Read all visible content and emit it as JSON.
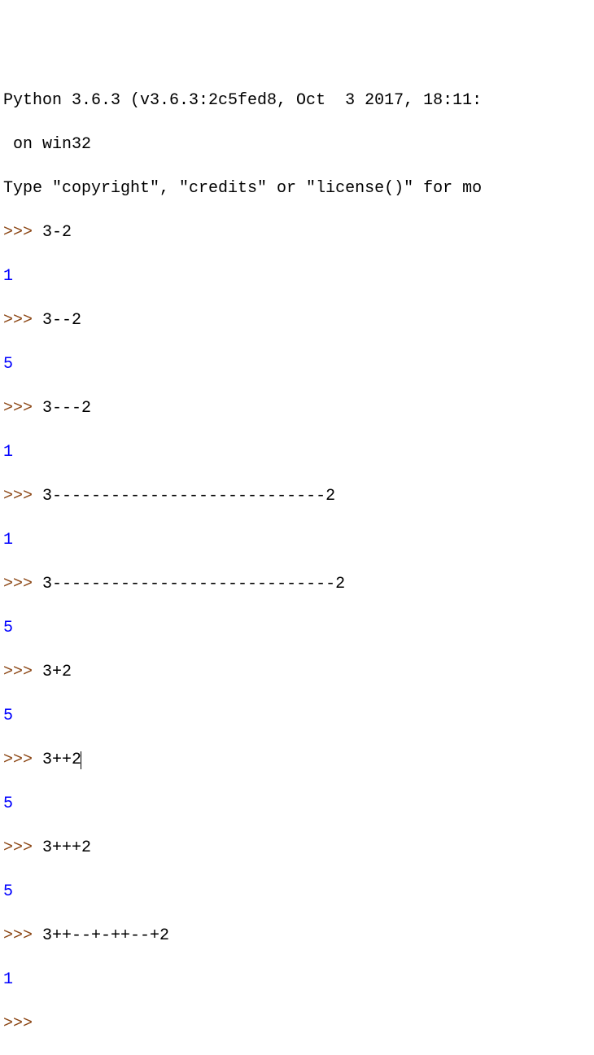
{
  "header": {
    "line1": "Python 3.6.3 (v3.6.3:2c5fed8, Oct  3 2017, 18:11:",
    "line2": " on win32",
    "line3": "Type \"copyright\", \"credits\" or \"license()\" for mo"
  },
  "prompt": ">>> ",
  "session": [
    {
      "input": "3-2",
      "output": "1"
    },
    {
      "input": "3--2",
      "output": "5"
    },
    {
      "input": "3---2",
      "output": "1"
    },
    {
      "input": "3----------------------------2",
      "output": "1"
    },
    {
      "input": "3-----------------------------2",
      "output": "5"
    },
    {
      "input": "3+2",
      "output": "5"
    },
    {
      "input": "3++2",
      "output": "5",
      "cursor": true
    },
    {
      "input": "3+++2",
      "output": "5"
    },
    {
      "input": "3++--+-++--+2",
      "output": "1"
    }
  ]
}
